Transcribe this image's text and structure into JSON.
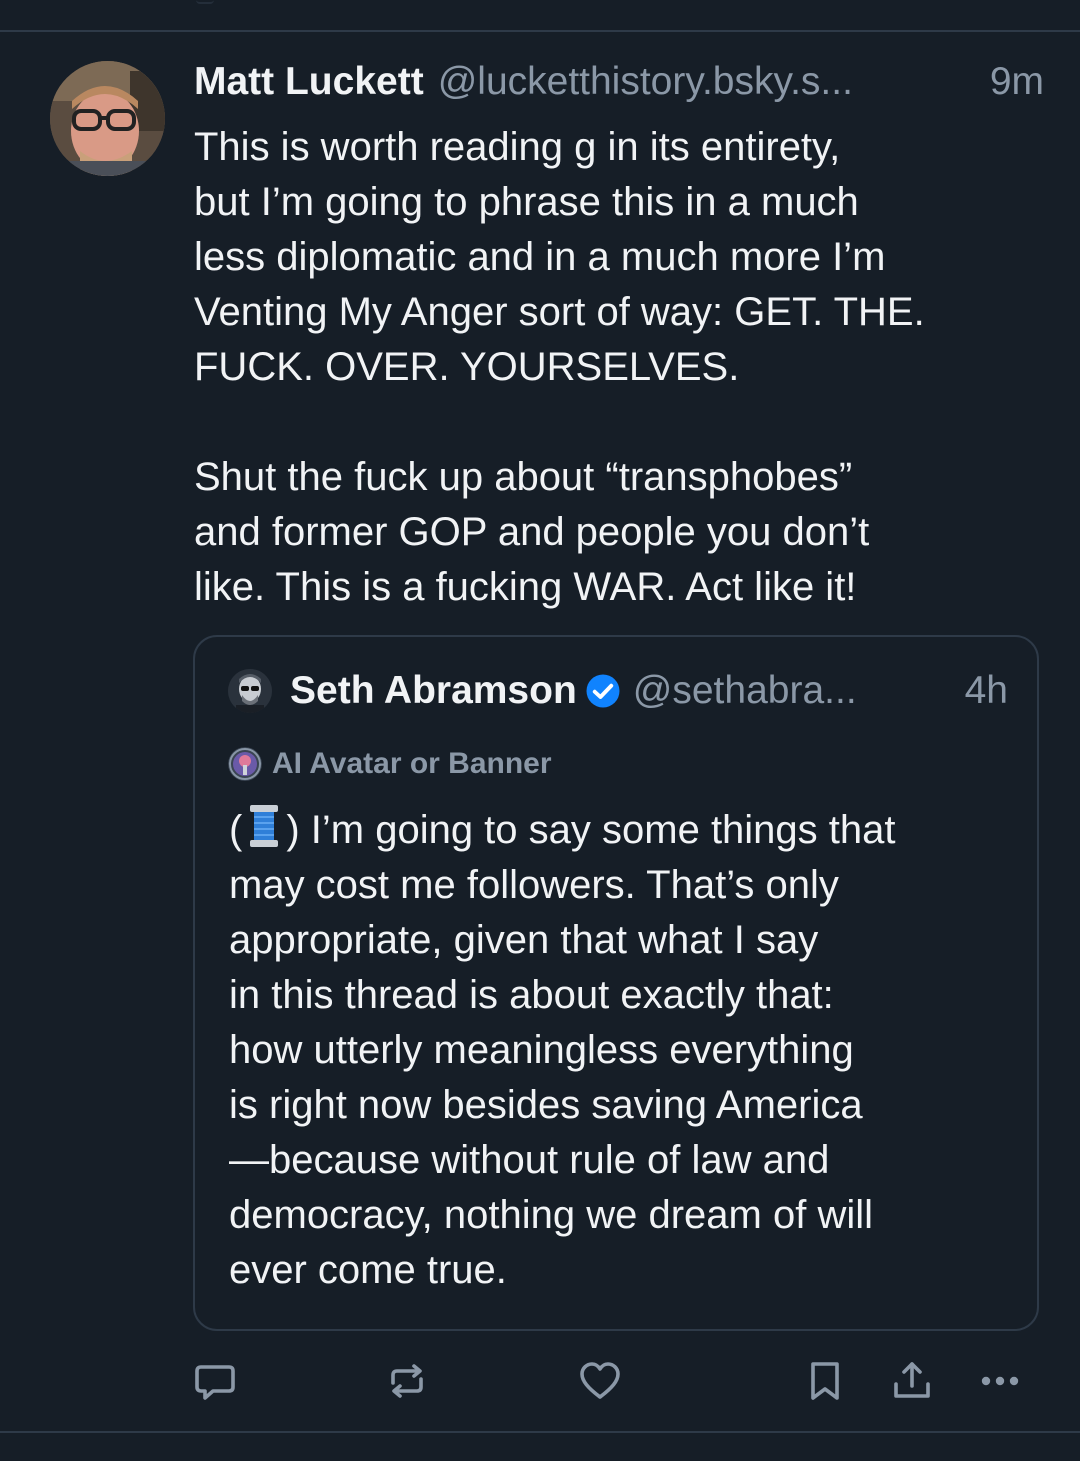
{
  "post": {
    "author_name": "Matt Luckett",
    "author_handle": "@lucketthistory.bsky.s...",
    "time": "9m",
    "text": "This is worth reading g in its entirety,\nbut I’m going to phrase this in a much\nless diplomatic and in a much more I’m\nVenting My Anger sort of way: GET. THE.\nFUCK. OVER. YOURSELVES.\n\nShut the fuck up about “transphobes”\nand former GOP and people you don’t\nlike. This is a fucking WAR. Act like it!"
  },
  "quote": {
    "author_name": "Seth Abramson",
    "author_handle": "@sethabra...",
    "time": "4h",
    "label": "AI Avatar or Banner",
    "text_open": "(",
    "text_after_spool": ") I’m going to say some things that\nmay cost me followers. That’s only\nappropriate, given that what I say\nin this thread is about exactly that:\nhow utterly meaningless everything\nis right now besides saving America\n—because without rule of law and\ndemocracy, nothing we dream of will\never come true."
  },
  "icons": {
    "reply": "reply-icon",
    "repost": "repost-icon",
    "like": "heart-icon",
    "bookmark": "bookmark-icon",
    "share": "share-icon",
    "more": "more-icon",
    "verified": "verified-badge-icon",
    "spool": "thread-spool-emoji"
  },
  "colors": {
    "background": "#161e27",
    "text": "#f1f3f5",
    "muted": "#8b98a7",
    "border": "#2e3a48",
    "verified": "#1083fe"
  }
}
